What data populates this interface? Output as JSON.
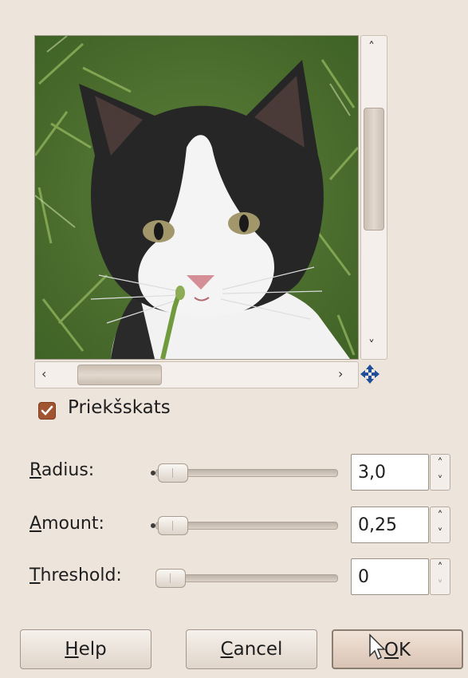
{
  "preview": {
    "image_alt": "black and white kitten in grass",
    "scroll_up_icon": "chevron-up-icon",
    "scroll_down_icon": "chevron-down-icon",
    "scroll_left_icon": "chevron-left-icon",
    "scroll_right_icon": "chevron-right-icon",
    "navigate_icon": "move-arrows-icon"
  },
  "preview_toggle": {
    "label": "Priekšskats",
    "checked": true
  },
  "params": [
    {
      "mnemonic": "R",
      "rest": "adius:",
      "value": "3,0",
      "level": 0.03
    },
    {
      "mnemonic": "A",
      "rest": "mount:",
      "value": "0,25",
      "level": 0.03
    },
    {
      "mnemonic": "T",
      "rest": "hreshold:",
      "value": "0",
      "level": 0.0
    }
  ],
  "buttons": {
    "help": {
      "mnemonic": "H",
      "rest": "elp"
    },
    "cancel": {
      "mnemonic": "C",
      "rest": "ancel"
    },
    "ok": {
      "mnemonic": "O",
      "rest": "K"
    }
  },
  "colors": {
    "background": "#ede4dc",
    "checkbox": "#a0542f",
    "nav_icon": "#1f4f9a"
  }
}
